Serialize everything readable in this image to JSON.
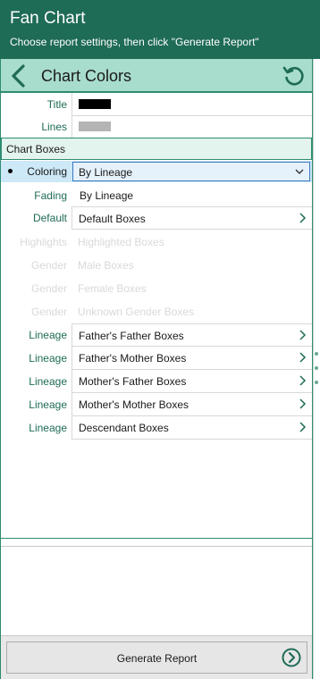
{
  "header": {
    "title": "Fan Chart",
    "subtitle": "Choose report settings, then click \"Generate Report\""
  },
  "subbar": {
    "title": "Chart Colors",
    "back_icon": "chevron-left-icon",
    "reset_icon": "reset-icon"
  },
  "colors": {
    "header_bg": "#1e6b56",
    "subbar_bg": "#a8dccc",
    "accent": "#2d8c70",
    "title_swatch": "#000000",
    "lines_swatch": "#b4b4b4"
  },
  "top_rows": [
    {
      "label": "Title"
    },
    {
      "label": "Lines"
    }
  ],
  "section": {
    "label": "Chart Boxes"
  },
  "coloring": {
    "label": "Coloring",
    "value": "By Lineage"
  },
  "rows": [
    {
      "label": "Fading",
      "value": "By Lineage"
    },
    {
      "label": "Default",
      "value": "Default Boxes"
    },
    {
      "label": "Highlights",
      "value": "Highlighted Boxes"
    },
    {
      "label": "Gender",
      "value": "Male Boxes"
    },
    {
      "label": "Gender",
      "value": "Female Boxes"
    },
    {
      "label": "Gender",
      "value": "Unknown Gender Boxes"
    },
    {
      "label": "Lineage",
      "value": "Father's Father Boxes"
    },
    {
      "label": "Lineage",
      "value": "Father's Mother Boxes"
    },
    {
      "label": "Lineage",
      "value": "Mother's Father Boxes"
    },
    {
      "label": "Lineage",
      "value": "Mother's Mother Boxes"
    },
    {
      "label": "Lineage",
      "value": "Descendant Boxes"
    }
  ],
  "footer": {
    "generate_label": "Generate Report",
    "generate_icon": "arrow-circle-right-icon"
  }
}
